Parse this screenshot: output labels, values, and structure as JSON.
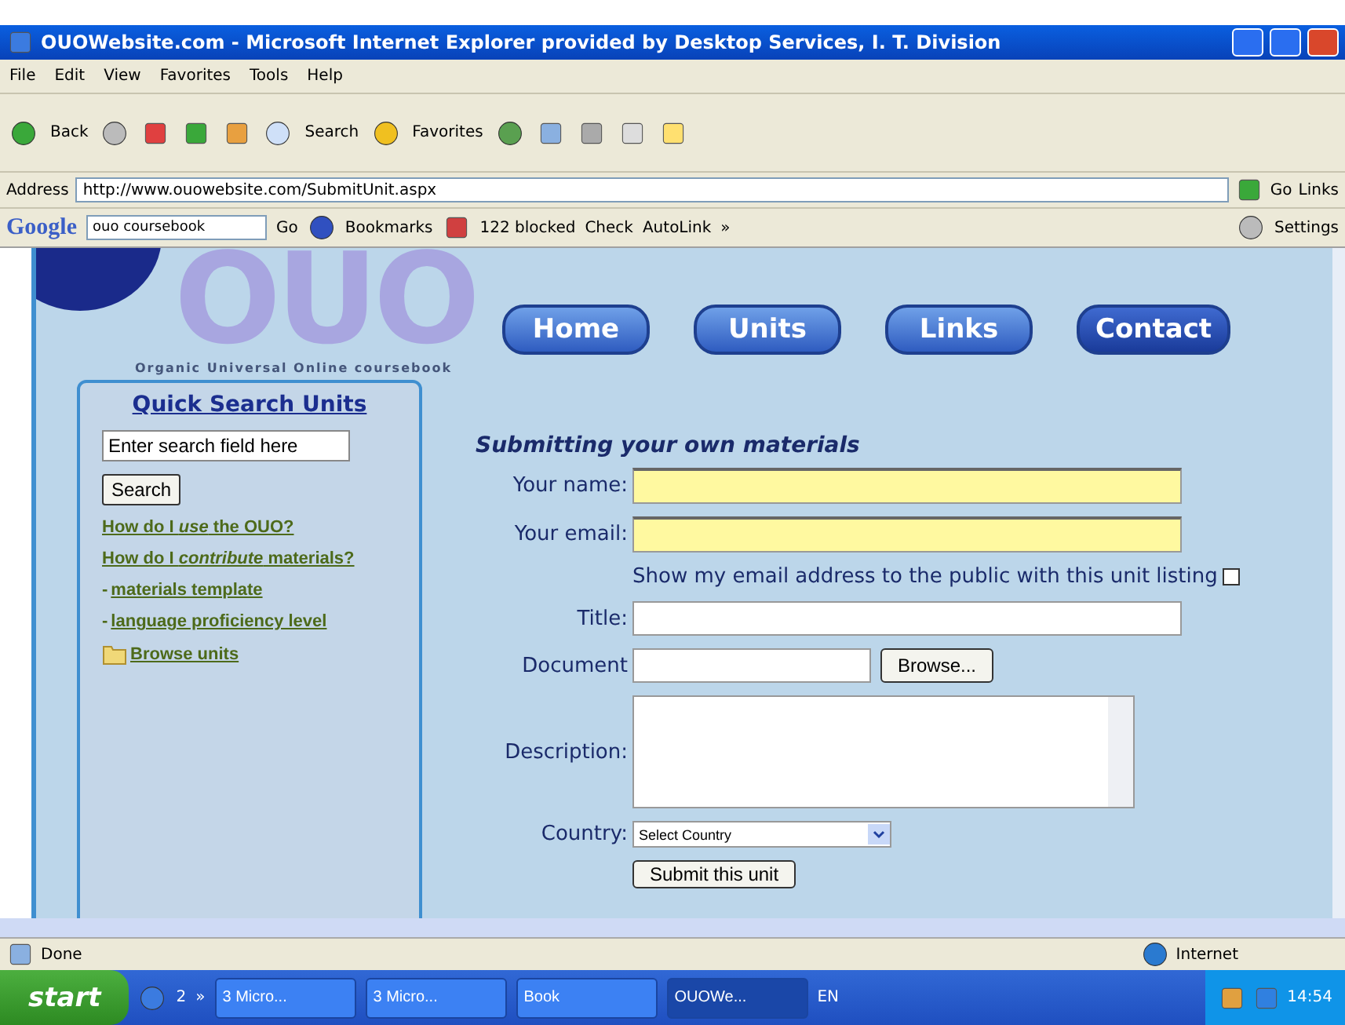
{
  "window": {
    "title": "OUOWebsite.com - Microsoft Internet Explorer provided by Desktop Services, I. T. Division"
  },
  "menu": [
    "File",
    "Edit",
    "View",
    "Favorites",
    "Tools",
    "Help"
  ],
  "toolbar": {
    "back": "Back",
    "search": "Search",
    "favorites": "Favorites"
  },
  "address": {
    "label": "Address",
    "value": "http://www.ouowebsite.com/SubmitUnit.aspx",
    "go": "Go",
    "links": "Links"
  },
  "google_bar": {
    "logo": "Google",
    "query": "ouo coursebook",
    "go": "Go",
    "bookmarks": "Bookmarks",
    "blocked": "122 blocked",
    "check": "Check",
    "autolink": "AutoLink",
    "more": "»",
    "settings": "Settings"
  },
  "site": {
    "logo": "OUO",
    "tagline": "Organic Universal Online coursebook",
    "nav": [
      "Home",
      "Units",
      "Links",
      "Contact"
    ],
    "sidebar": {
      "title": "Quick Search Units",
      "search_value": "Enter search field here",
      "search_button": "Search",
      "links": [
        {
          "kind": "question",
          "text": "How do I *use* the OUO?"
        },
        {
          "kind": "question",
          "text": "How do I *contribute* materials?"
        },
        {
          "kind": "dash",
          "prefix": "-",
          "text": "materials template"
        },
        {
          "kind": "dash",
          "prefix": "-",
          "text": "language proficiency level"
        },
        {
          "kind": "folder",
          "text": "Browse units"
        }
      ]
    },
    "form": {
      "heading": "Submitting your own materials",
      "fields": [
        {
          "kind": "text",
          "label": "Your name:",
          "required": true
        },
        {
          "kind": "text",
          "label": "Your email:",
          "required": true
        },
        {
          "kind": "checkbox",
          "label": "Show my email address to the public with this unit listing",
          "checked": false
        },
        {
          "kind": "text",
          "label": "Title:",
          "required": false
        },
        {
          "kind": "file",
          "label": "Document",
          "button": "Browse..."
        },
        {
          "kind": "textarea",
          "label": "Description:"
        },
        {
          "kind": "select",
          "label": "Country:",
          "value": "Select Country"
        }
      ],
      "submit": "Submit this unit"
    }
  },
  "status_bar": {
    "text": "Done",
    "zone": "Internet"
  },
  "taskbar": {
    "start": "start",
    "quick_count": "2",
    "more": "»",
    "tasks": [
      {
        "label": "3 Micro...",
        "selected": false
      },
      {
        "label": "3 Micro...",
        "selected": false
      },
      {
        "label": "Book",
        "selected": false
      },
      {
        "label": "OUOWe...",
        "selected": true
      }
    ],
    "language": "EN",
    "clock": "14:54"
  }
}
